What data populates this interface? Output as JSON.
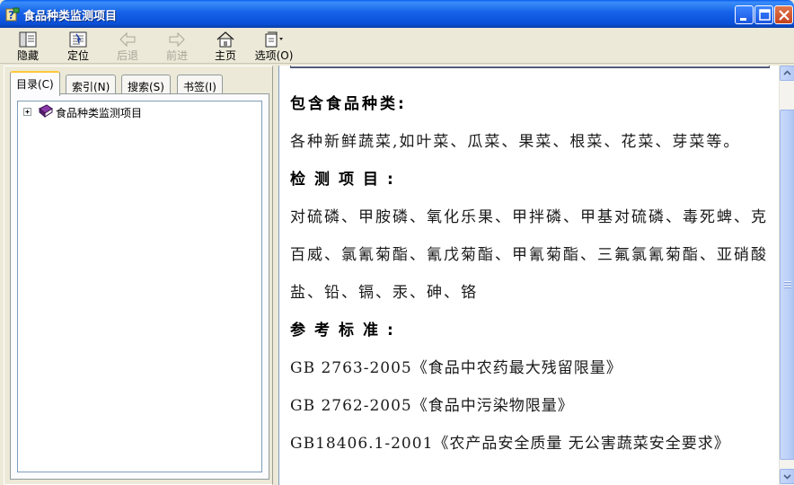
{
  "window": {
    "title": "食品种类监测项目"
  },
  "toolbar": {
    "buttons": [
      {
        "label": "隐藏",
        "icon": "hide-pane-icon",
        "enabled": true
      },
      {
        "label": "定位",
        "icon": "locate-icon",
        "enabled": true
      },
      {
        "label": "后退",
        "icon": "back-arrow-icon",
        "enabled": false
      },
      {
        "label": "前进",
        "icon": "forward-arrow-icon",
        "enabled": false
      },
      {
        "label": "主页",
        "icon": "home-icon",
        "enabled": true
      },
      {
        "label": "选项(O)",
        "icon": "options-icon",
        "enabled": true
      }
    ]
  },
  "nav": {
    "tabs": [
      {
        "label": "目录(C)",
        "active": true
      },
      {
        "label": "索引(N)",
        "active": false
      },
      {
        "label": "搜索(S)",
        "active": false
      },
      {
        "label": "书签(I)",
        "active": false
      }
    ],
    "tree": [
      {
        "label": "食品种类监测项目",
        "icon": "closed-book-icon",
        "expander": "+"
      }
    ]
  },
  "content": {
    "sections": [
      {
        "heading": "包含食品种类:",
        "body": "各种新鲜蔬菜,如叶菜、瓜菜、果菜、根菜、花菜、芽菜等。"
      },
      {
        "heading": "检测项目:",
        "body": "对硫磷、甲胺磷、氧化乐果、甲拌磷、甲基对硫磷、毒死蜱、克百威、氯氰菊酯、氰戊菊酯、甲氰菊酯、三氟氯氰菊酯、亚硝酸盐、铅、镉、汞、砷、铬"
      },
      {
        "heading": "参考标准:",
        "refs": [
          "GB 2763-2005《食品中农药最大残留限量》",
          "GB 2762-2005《食品中污染物限量》",
          "GB18406.1-2001《农产品安全质量 无公害蔬菜安全要求》"
        ]
      }
    ]
  },
  "colors": {
    "titlebar": "#0a50d8",
    "chrome": "#ece9d8",
    "tab_highlight": "#ffc83c",
    "scrollbar": "#b4c9f5"
  }
}
